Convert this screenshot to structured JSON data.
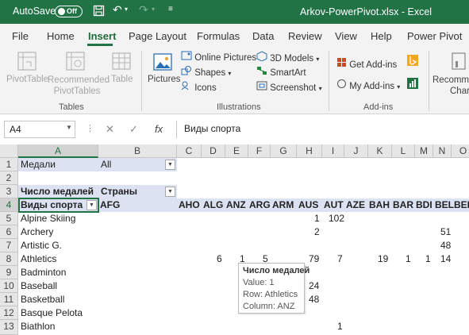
{
  "titlebar": {
    "autosave": "AutoSave",
    "toggle": "Off",
    "filename": "Arkov-PowerPivot.xlsx",
    "app": "Excel",
    "title_sep": "-"
  },
  "ribbon_tabs": [
    "File",
    "Home",
    "Insert",
    "Page Layout",
    "Formulas",
    "Data",
    "Review",
    "View",
    "Help",
    "Power Pivot"
  ],
  "active_tab": "Insert",
  "ribbon": {
    "tables": {
      "pivot": "PivotTable",
      "recommended1": "Recommended",
      "recommended2": "PivotTables",
      "table": "Table",
      "label": "Tables"
    },
    "illustrations": {
      "pictures": "Pictures",
      "online": "Online Pictures",
      "shapes": "Shapes",
      "icons": "Icons",
      "models": "3D Models",
      "smartart": "SmartArt",
      "screenshot": "Screenshot",
      "label": "Illustrations"
    },
    "addins": {
      "get": "Get Add-ins",
      "my": "My Add-ins",
      "label": "Add-ins"
    },
    "charts": {
      "recommended1": "Recomme",
      "recommended2": "Chart"
    }
  },
  "formula_bar": {
    "namebox": "A4",
    "fx": "fx",
    "value": "Виды спорта"
  },
  "columns": [
    "A",
    "B",
    "C",
    "D",
    "E",
    "F",
    "G",
    "H",
    "I",
    "J",
    "K",
    "L",
    "M",
    "N",
    "O"
  ],
  "rows": [
    "1",
    "2",
    "3",
    "4",
    "5",
    "6",
    "7",
    "8",
    "9",
    "10",
    "11",
    "12",
    "13"
  ],
  "pivot": {
    "filter_label": "Медали",
    "filter_value": "All",
    "values_label": "Число медалей",
    "columns_label": "Страны",
    "rows_label": "Виды спорта",
    "countries": [
      "AFG",
      "AHO",
      "ALG",
      "ANZ",
      "ARG",
      "ARM",
      "AUS",
      "AUT",
      "AZE",
      "BAH",
      "BAR",
      "BDI",
      "BEL",
      "BER"
    ],
    "sports": [
      "Alpine Skiing",
      "Archery",
      "Artistic G.",
      "Athletics",
      "Badminton",
      "Baseball",
      "Basketball",
      "Basque Pelota",
      "Biathlon"
    ],
    "values": {
      "alpine_aut": "102",
      "alpine_aus": "1",
      "archery_aus": "2",
      "archery_bel": "51",
      "artistic_bel": "48",
      "ath_alg": "6",
      "ath_anz": "1",
      "ath_arg": "5",
      "ath_aus": "79",
      "ath_aut": "7",
      "ath_bah": "19",
      "ath_bar": "1",
      "ath_bdi": "1",
      "ath_bel": "14",
      "baseball_aus": "24",
      "basketball_aus": "48",
      "biathlon_aut": "1"
    }
  },
  "tooltip": {
    "title": "Число медалей",
    "value": "Value: 1",
    "row": "Row: Athletics",
    "column": "Column: ANZ"
  },
  "colors": {
    "excel_green": "#217346",
    "pivot_band": "#dde2f2"
  }
}
